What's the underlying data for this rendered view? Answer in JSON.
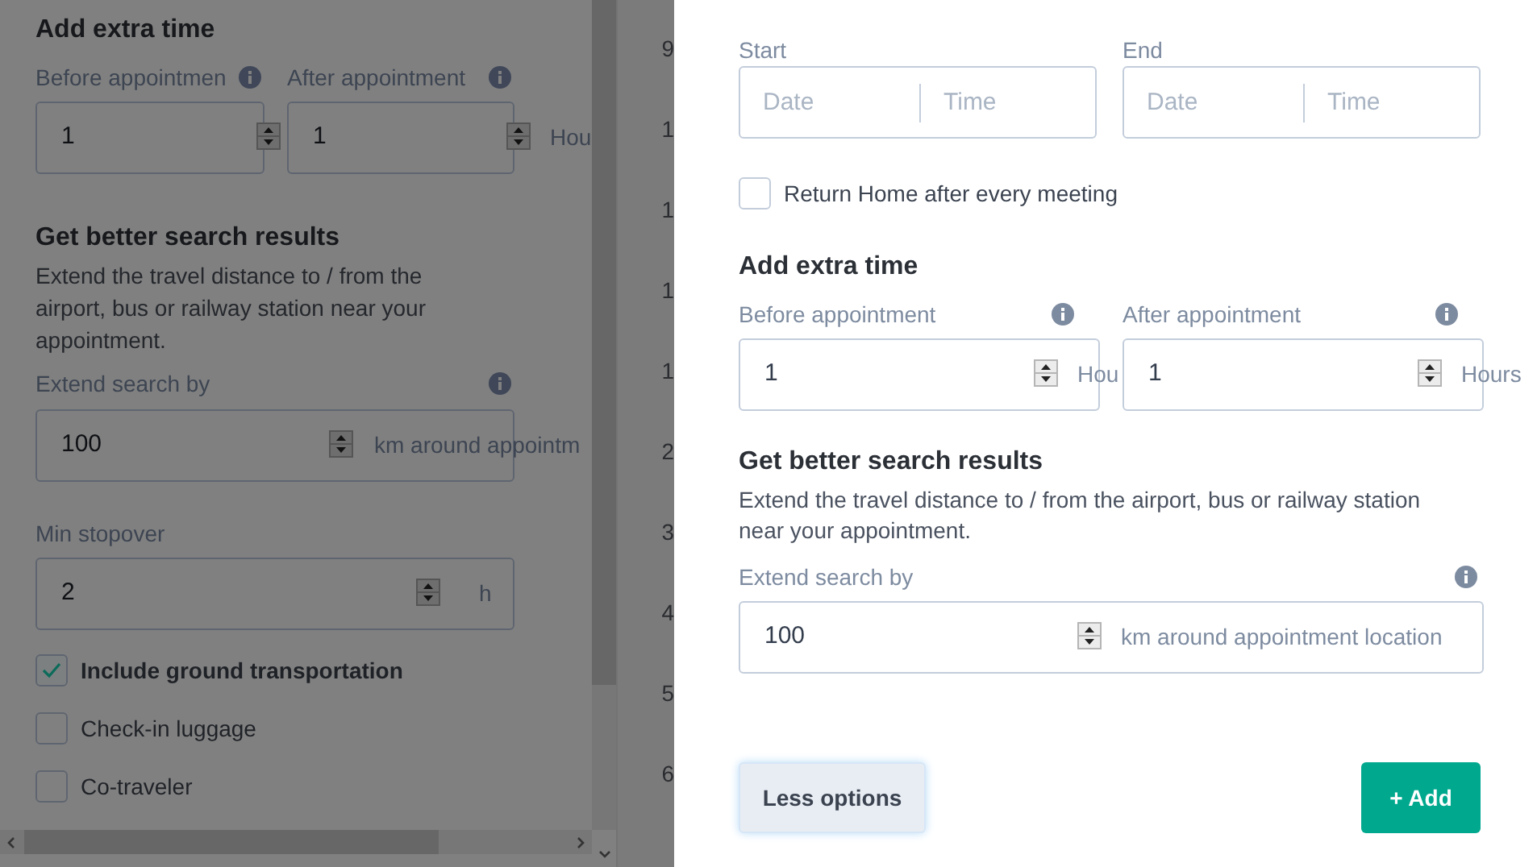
{
  "background_panel": {
    "extra_time": {
      "heading": "Add extra time",
      "fields": [
        {
          "label": "Before appointmen",
          "value": "1"
        },
        {
          "label": "After appointment",
          "value": "1",
          "unit": "Hou"
        }
      ]
    },
    "search": {
      "heading": "Get better search results",
      "description": "Extend the travel distance to / from the airport, bus or railway station near your appointment.",
      "label": "Extend search by",
      "value": "100",
      "unit": "km around appointm"
    },
    "stopover": {
      "label": "Min stopover",
      "value": "2",
      "unit": "h"
    },
    "options": [
      {
        "label": "Include ground transportation",
        "checked": true
      },
      {
        "label": "Check-in luggage",
        "checked": false
      },
      {
        "label": "Co-traveler",
        "checked": false
      }
    ]
  },
  "calendar_hours": [
    "9",
    "1",
    "1",
    "1",
    "1",
    "2",
    "3",
    "4",
    "5",
    "6"
  ],
  "drawer": {
    "range": [
      {
        "label": "Start",
        "date_placeholder": "Date",
        "time_placeholder": "Time"
      },
      {
        "label": "End",
        "date_placeholder": "Date",
        "time_placeholder": "Time"
      }
    ],
    "return_home": {
      "label": "Return Home after every meeting",
      "checked": false
    },
    "extra_time": {
      "heading": "Add extra time",
      "fields": [
        {
          "label": "Before appointment",
          "value": "1",
          "unit": "Hou"
        },
        {
          "label": "After appointment",
          "value": "1",
          "unit": "Hours"
        }
      ]
    },
    "search": {
      "heading": "Get better search results",
      "description": "Extend the travel distance to / from the airport, bus or railway station near your appointment.",
      "label": "Extend search by",
      "value": "100",
      "unit": "km around appointment location"
    },
    "buttons": [
      {
        "label": "Less options",
        "kind": "secondary"
      },
      {
        "label": "+ Add",
        "kind": "primary"
      }
    ]
  }
}
